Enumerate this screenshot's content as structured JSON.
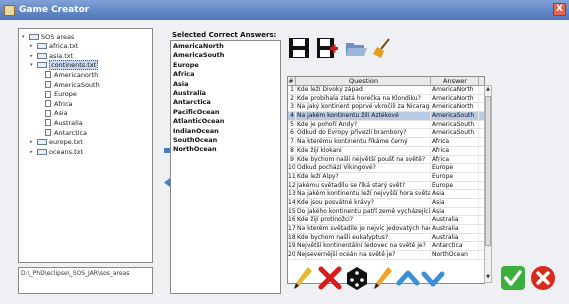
{
  "window": {
    "title": "Game Creator",
    "close_label": "X"
  },
  "tree": {
    "items": [
      {
        "label": "SOS areas",
        "kind": "root",
        "level": 0,
        "expanded": true
      },
      {
        "label": "africa.txt",
        "kind": "folder",
        "level": 1
      },
      {
        "label": "asia.txt",
        "kind": "folder",
        "level": 1
      },
      {
        "label": "continents.txt",
        "kind": "folder",
        "level": 1,
        "selected": true,
        "expanded": true
      },
      {
        "label": "Americanorth",
        "kind": "file",
        "level": 2
      },
      {
        "label": "AmericaSouth",
        "kind": "file",
        "level": 2
      },
      {
        "label": "Europe",
        "kind": "file",
        "level": 2
      },
      {
        "label": "Africa",
        "kind": "file",
        "level": 2
      },
      {
        "label": "Asia",
        "kind": "file",
        "level": 2
      },
      {
        "label": "Australia",
        "kind": "file",
        "level": 2
      },
      {
        "label": "Antarctica",
        "kind": "file",
        "level": 2
      },
      {
        "label": "europe.txt",
        "kind": "folder",
        "level": 1
      },
      {
        "label": "oceans.txt",
        "kind": "folder",
        "level": 1
      }
    ],
    "path": "D:\\_PhD\\eclipse\\_SOS_JAR\\sos_areas"
  },
  "answers": {
    "title": "Selected Correct Answers:",
    "items": [
      "AmericaNorth",
      "AmericaSouth",
      "Europe",
      "Africa",
      "Asia",
      "Australia",
      "Antarctica",
      "PacificOcean",
      "AtlanticOcean",
      "IndianOcean",
      "SouthOcean",
      "NorthOcean"
    ]
  },
  "table": {
    "headers": [
      "#",
      "Question",
      "Answer"
    ],
    "rows": [
      [
        "1",
        "Kde leží Divoký západ",
        "AmericaNorth"
      ],
      [
        "2",
        "Kde probíhala zlatá horečka na Klondiku?",
        "AmericaNorth"
      ],
      [
        "3",
        "Na jaký kontinent poprvé vkročili za Nicaraguou?",
        "AmericaNorth"
      ],
      [
        "4",
        "Na jakém kontinentu žili Aztékové",
        "AmericaSouth"
      ],
      [
        "5",
        "Kde je pohoří Andy?",
        "AmericaSouth"
      ],
      [
        "6",
        "Odkud do Evropy přivezli brambory?",
        "AmericaSouth"
      ],
      [
        "7",
        "Na kterému kontinentu říkáme černý",
        "Africa"
      ],
      [
        "8",
        "Kde žijí klokani",
        "Africa"
      ],
      [
        "9",
        "Kde bychom našli největší poušť na světě?",
        "Africa"
      ],
      [
        "10",
        "Odkud pochází Vikingové?",
        "Europe"
      ],
      [
        "11",
        "Kde leží Alpy?",
        "Europe"
      ],
      [
        "12",
        "Jakému světadílu se říká starý svět?",
        "Europe"
      ],
      [
        "13",
        "Na jakém kontinentu leží nejvyšší hora světa?",
        "Asia"
      ],
      [
        "14",
        "Kde jsou posvátné krávy?",
        "Asia"
      ],
      [
        "15",
        "Do jakého kontinentu patří země vycházejícího slunce?",
        "Asia"
      ],
      [
        "16",
        "Kde žijí protinožci?",
        "Australia"
      ],
      [
        "17",
        "Na kterém světadíle je nejvíc jedovatých hadů?",
        "Australia"
      ],
      [
        "18",
        "Kde bychom našli eukalyptus?",
        "Australia"
      ],
      [
        "19",
        "Největší kontinentální ledovec na světě je?",
        "Antarctica"
      ],
      [
        "20",
        "Nejsevernější oceán na světě je?",
        "NorthOcean"
      ]
    ],
    "selected_row": 3
  },
  "icons": {
    "toolbar": [
      "save-icon",
      "save-as-icon",
      "open-folder-icon",
      "clear-broom-icon"
    ],
    "bottom": [
      "edit-pencil-icon",
      "delete-x-icon",
      "random-dice-icon",
      "edit-pencil-icon",
      "move-up-icon",
      "move-down-icon",
      "confirm-check-icon",
      "cancel-icon"
    ]
  },
  "colors": {
    "accent": "#4d74b8",
    "selection": "#b9cbe3",
    "arrow": "#3f7fc2"
  }
}
